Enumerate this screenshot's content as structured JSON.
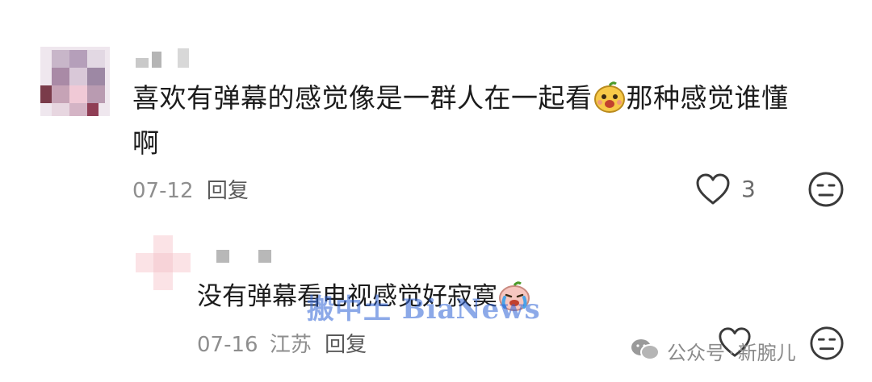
{
  "comments": [
    {
      "content": "喜欢有弹幕的感觉像是一群人在一起看",
      "content_after_emoji": "那种感觉谁懂",
      "content_line2": "啊",
      "emoji": "laughing-face-emoji",
      "date": "07-12",
      "reply_label": "回复",
      "like_count": "3"
    },
    {
      "content": "没有弹幕看电视感觉好寂寞",
      "emoji": "crying-face-emoji",
      "date": "07-16",
      "location": "江苏",
      "reply_label": "回复"
    }
  ],
  "watermark": "搬中土 BiaNews",
  "account": {
    "prefix": "公众号",
    "separator": "·",
    "name": "新腕儿"
  },
  "colors": {
    "text": "#1c1c1c",
    "meta": "#8e8e8e",
    "watermark": "#2f63d6"
  }
}
